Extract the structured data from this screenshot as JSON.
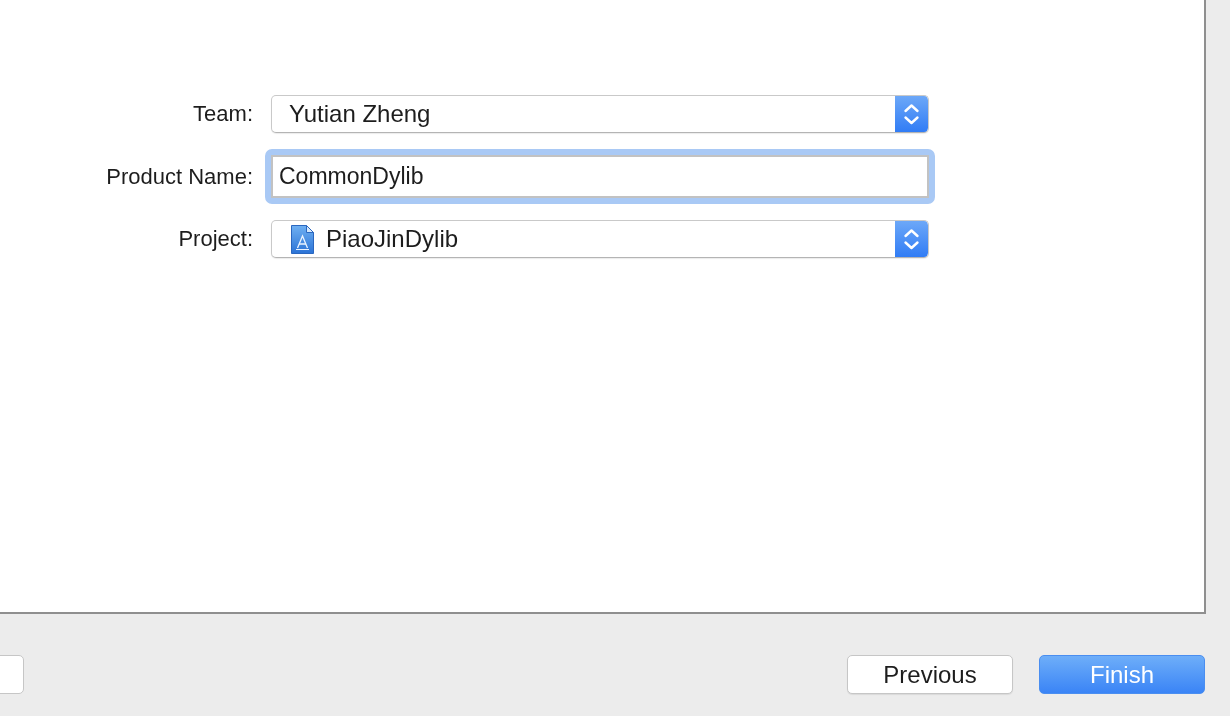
{
  "form": {
    "fields": [
      {
        "kind": "popup",
        "label": "Team:",
        "value": "Yutian Zheng",
        "focused": false
      },
      {
        "kind": "text",
        "label": "Product Name:",
        "value": "CommonDylib",
        "focused": true
      },
      {
        "kind": "file-popup",
        "label": "Project:",
        "value": "PiaoJinDylib",
        "focused": false
      }
    ]
  },
  "buttons": [
    {
      "kind": "normal",
      "label": "Previous"
    },
    {
      "kind": "default",
      "label": "Finish"
    }
  ]
}
